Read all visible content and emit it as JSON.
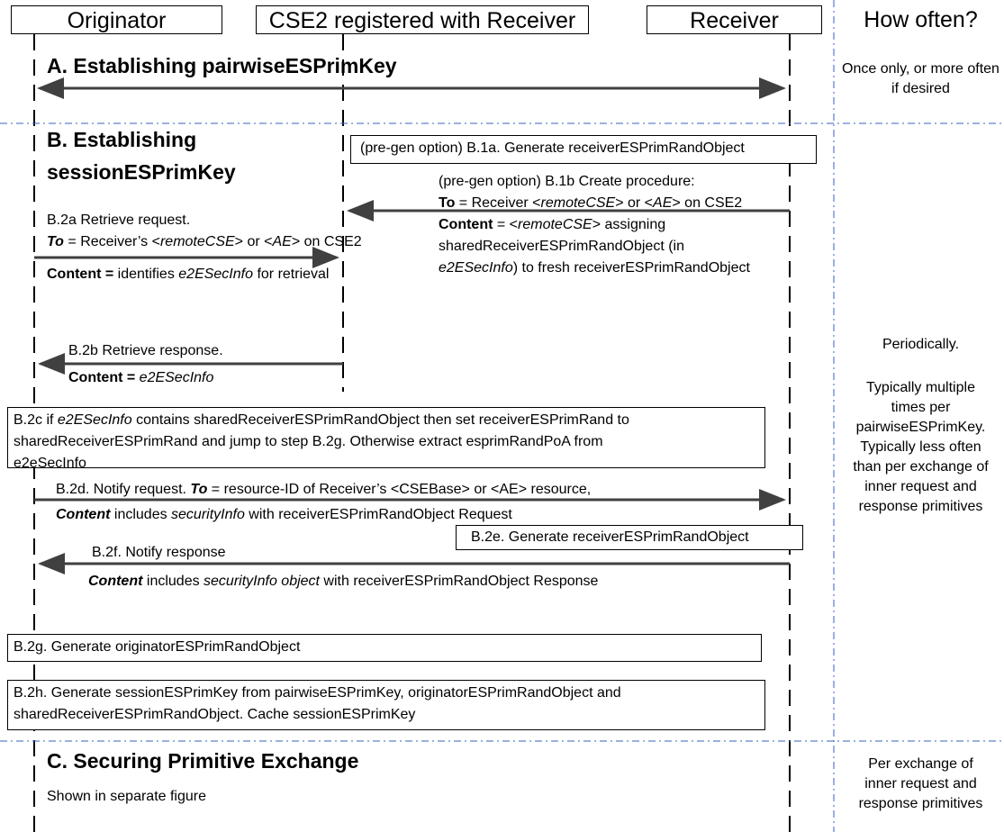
{
  "headers": {
    "originator": "Originator",
    "cse2": "CSE2 registered with Receiver",
    "receiver": "Receiver",
    "how_often": "How often?"
  },
  "section_a": {
    "title": "A. Establishing pairwiseESPrimKey",
    "how": "Once only, or more often if desired"
  },
  "section_b": {
    "title_line1": "B. Establishing",
    "title_line2": "sessionESPrimKey",
    "b1a": "(pre-gen option) B.1a.  Generate receiverESPrimRandObject",
    "b1b": {
      "line1": "(pre-gen option) B.1b Create procedure:",
      "to_label": "To",
      "to_pre": " =  Receiver <",
      "to_i1": "remoteCSE",
      "to_mid": "> or <",
      "to_i2": "AE",
      "to_post": "> on CSE2",
      "content_label": "Content",
      "content_pre": " = <",
      "content_i1": "remoteCSE",
      "content_post": "> assigning",
      "line4": "sharedReceiverESPrimRandObject (in",
      "line5_i": "e2ESecInfo",
      "line5_post": ") to fresh receiverESPrimRandObject"
    },
    "b2a": {
      "line1": "B.2a  Retrieve request.",
      "to_label": "To",
      "to_pre": " =  Receiver’s <",
      "to_i1": "remoteCSE",
      "to_mid": "> or <",
      "to_i2": "AE",
      "to_post": "> on CSE2",
      "content_label": "Content =",
      "content_pre": " identifies ",
      "content_i": "e2ESecInfo",
      "content_post": " for retrieval"
    },
    "b2b": {
      "line1": "B.2b  Retrieve response.",
      "content_label": "Content =",
      "content_i": " e2ESecInfo"
    },
    "b2c": {
      "pre": "B.2c if ",
      "i1": "e2ESecInfo",
      "mid": " contains  sharedReceiverESPrimRandObject then set receiverESPrimRand to",
      "line2": "sharedReceiverESPrimRand and jump to step B.2g. Otherwise extract esprimRandPoA from",
      "line3": "e2eSecInfo"
    },
    "b2d": {
      "pre": "B.2d. Notify request. ",
      "to_label": "To",
      "to_post": " = resource-ID of Receiver’s <CSEBase> or <AE> resource,",
      "content_label": "Content",
      "content_mid": " includes ",
      "content_i": "securityInfo",
      "content_post": " with receiverESPrimRandObject Request"
    },
    "b2e": "B.2e. Generate receiverESPrimRandObject",
    "b2f": {
      "line1": "B.2f. Notify response",
      "content_label": "Content",
      "content_mid": " includes ",
      "content_i": "securityInfo object",
      "content_post": " with receiverESPrimRandObject Response"
    },
    "b2g": "B.2g. Generate originatorESPrimRandObject",
    "b2h": {
      "line1": "B.2h. Generate sessionESPrimKey from pairwiseESPrimKey, originatorESPrimRandObject and",
      "line2": "sharedReceiverESPrimRandObject. Cache sessionESPrimKey"
    },
    "how": {
      "p1": "Periodically.",
      "p2": "Typically multiple times per pairwiseESPrimKey. Typically less often than per exchange of inner request and response primitives"
    }
  },
  "section_c": {
    "title": "C. Securing Primitive Exchange",
    "subtitle": "Shown in separate figure",
    "how": "Per exchange of inner request and response primitives"
  },
  "colors": {
    "lifeline": "#000000",
    "separator": "#3b5fc4",
    "arrow": "#404040"
  }
}
